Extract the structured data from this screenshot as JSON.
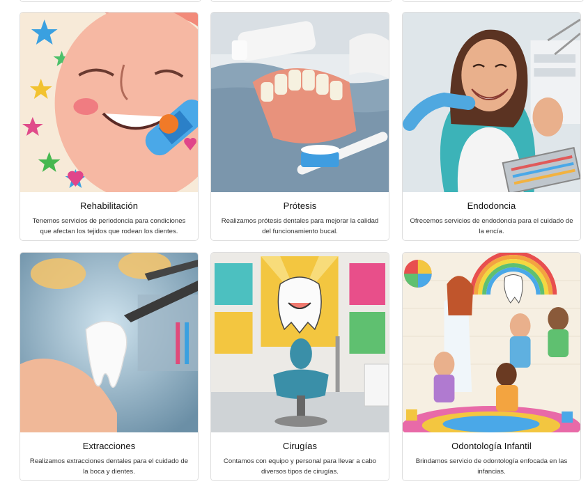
{
  "services": [
    {
      "title": "Rehabilitación",
      "description": "Tenemos servicios de periodoncia para condiciones que afectan los tejidos que rodean los dientes.",
      "image_icon": "cartoon-face-bandage-image"
    },
    {
      "title": "Prótesis",
      "description": "Realizamos prótesis dentales para mejorar la calidad del funcionamiento bucal.",
      "image_icon": "denture-toothbrush-image"
    },
    {
      "title": "Endodoncia",
      "description": "Ofrecemos servicios de endodoncia para el cuidado de la encía.",
      "image_icon": "smiling-patient-image"
    },
    {
      "title": "Extracciones",
      "description": "Realizamos extracciones dentales para el cuidado de la boca y dientes.",
      "image_icon": "extracted-tooth-image"
    },
    {
      "title": "Cirugías",
      "description": "Contamos con equipo y personal para llevar a cabo diversos tipos de cirugías.",
      "image_icon": "dental-chair-room-image"
    },
    {
      "title": "Odontología Infantil",
      "description": "Brindamos servicio de odontología enfocada en las infancias.",
      "image_icon": "kids-dentist-image"
    }
  ],
  "colors": {
    "card_border": "#dedede",
    "text": "#212529"
  }
}
